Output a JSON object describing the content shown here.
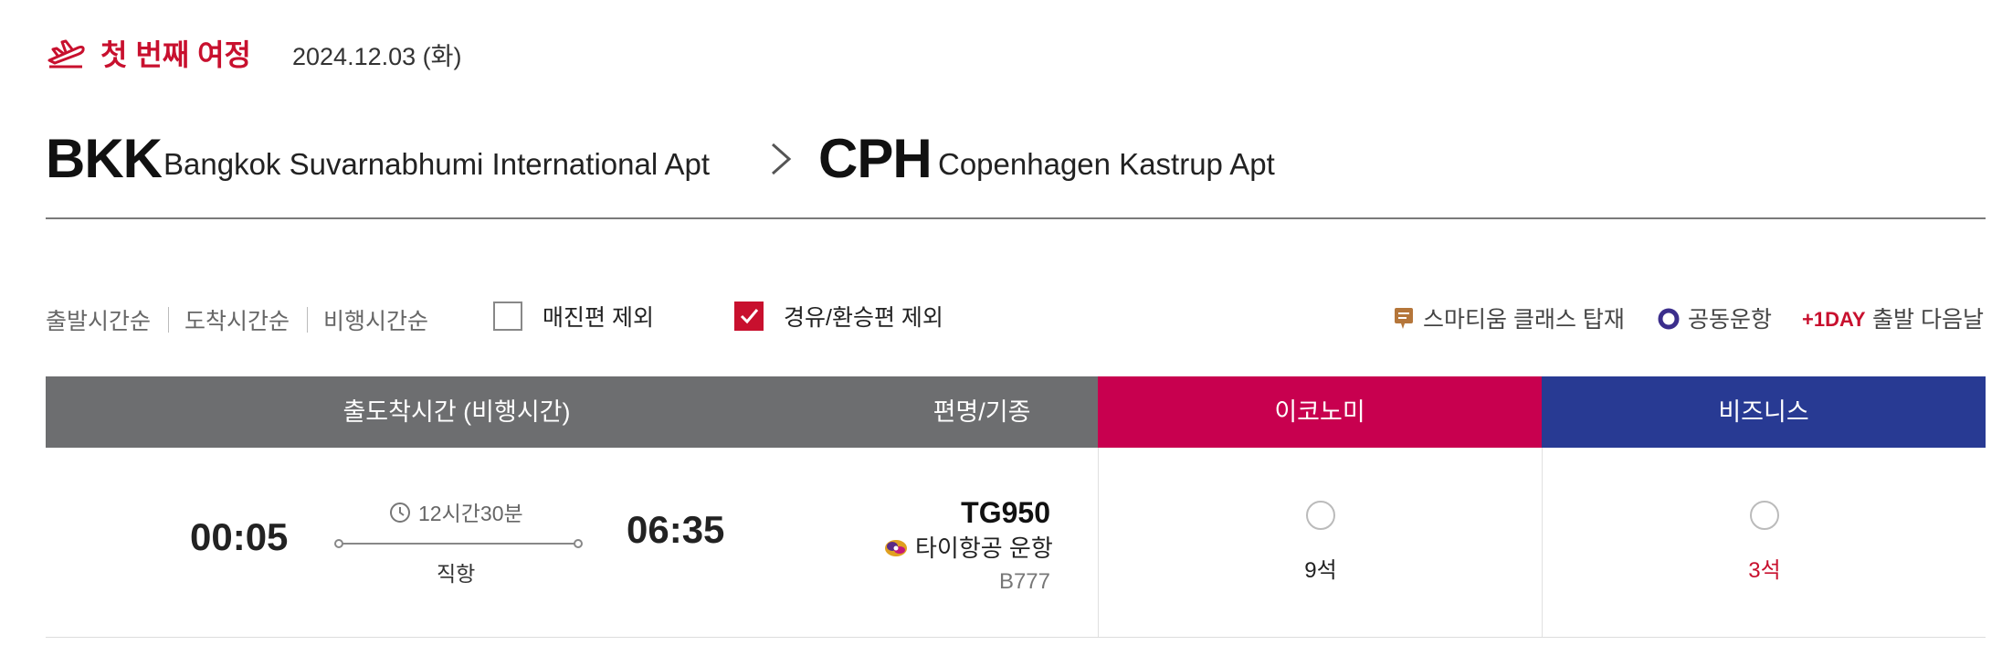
{
  "journey": {
    "title": "첫 번째 여정",
    "date": "2024.12.03 (화)",
    "icon": "plane-takeoff-icon"
  },
  "route": {
    "from_code": "BKK",
    "from_name": "Bangkok Suvarnabhumi International Apt",
    "to_code": "CPH",
    "to_name": "Copenhagen Kastrup Apt"
  },
  "sort": {
    "items": [
      "출발시간순",
      "도착시간순",
      "비행시간순"
    ]
  },
  "filters": {
    "sold_out": {
      "label": "매진편 제외",
      "checked": false
    },
    "transfer": {
      "label": "경유/환승편 제외",
      "checked": true
    }
  },
  "legend": {
    "smartium": "스마티움 클래스 탑재",
    "codeshare": "공동운항",
    "plus_day": "+1DAY",
    "plus_day_text": "출발 다음날"
  },
  "table": {
    "header_time": "출도착시간 (비행시간)",
    "header_flight": "편명/기종",
    "header_economy": "이코노미",
    "header_business": "비즈니스"
  },
  "flight": {
    "departure": "00:05",
    "arrival": "06:35",
    "duration": "12시간30분",
    "type": "직항",
    "number": "TG950",
    "operator": "타이항공 운항",
    "aircraft": "B777",
    "economy_seats": "9석",
    "business_seats": "3석"
  },
  "colors": {
    "brand_red": "#c8102e",
    "economy": "#c8004f",
    "business": "#283a93",
    "header_gray": "#6d6e70"
  }
}
